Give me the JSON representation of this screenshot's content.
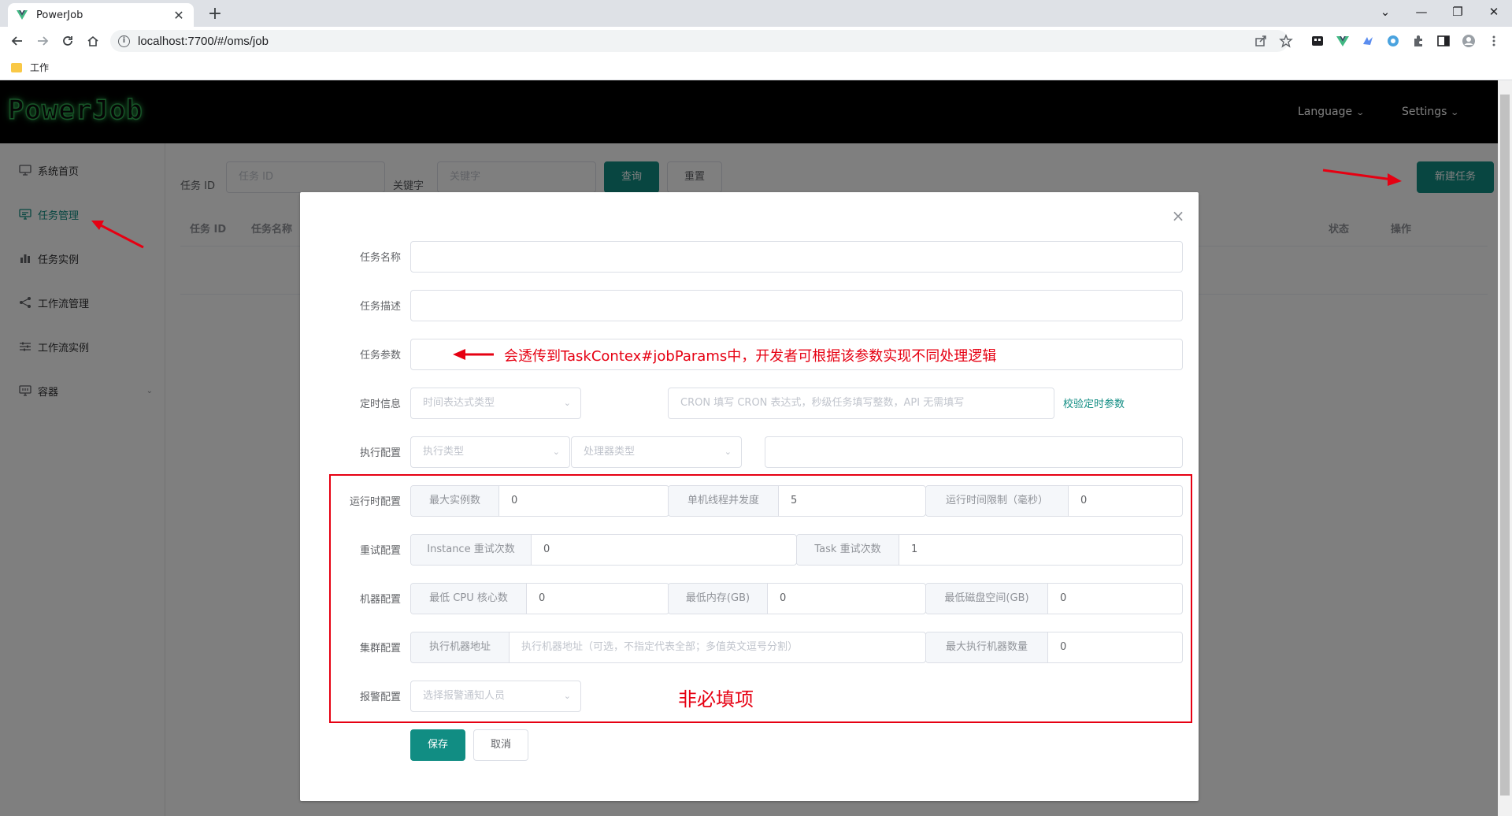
{
  "browser": {
    "tab_title": "PowerJob",
    "new_tab": "+",
    "url": "localhost:7700/#/oms/job",
    "bookmark": "工作",
    "win_min": "—",
    "win_restore": "❐",
    "win_close": "✕",
    "tab_menu": "⌄"
  },
  "app": {
    "logo": "PowerJob",
    "language_label": "Language",
    "settings_label": "Settings"
  },
  "sidebar": {
    "items": [
      {
        "label": "系统首页",
        "icon": "monitor-icon"
      },
      {
        "label": "任务管理",
        "icon": "task-icon"
      },
      {
        "label": "任务实例",
        "icon": "bar-chart-icon"
      },
      {
        "label": "工作流管理",
        "icon": "share-icon"
      },
      {
        "label": "工作流实例",
        "icon": "sliders-icon"
      },
      {
        "label": "容器",
        "icon": "container-icon"
      }
    ]
  },
  "filter": {
    "task_id_label": "任务 ID",
    "task_id_placeholder": "任务 ID",
    "keyword_label": "关键字",
    "keyword_placeholder": "关键字",
    "query_button": "查询",
    "reset_button": "重置",
    "new_task_button": "新建任务"
  },
  "table": {
    "headers": [
      "任务 ID",
      "任务名称",
      "状态",
      "操作"
    ]
  },
  "dialog": {
    "close": "×",
    "labels": {
      "name": "任务名称",
      "desc": "任务描述",
      "params": "任务参数",
      "timing": "定时信息",
      "exec": "执行配置",
      "runtime": "运行时配置",
      "retry": "重试配置",
      "machine": "机器配置",
      "cluster": "集群配置",
      "alarm": "报警配置"
    },
    "name_value": "",
    "desc_value": "",
    "params_value": "",
    "timing_type_placeholder": "时间表达式类型",
    "timing_expr_placeholder": "CRON 填写 CRON 表达式，秒级任务填写整数，API 无需填写",
    "validate_link": "校验定时参数",
    "exec_type_placeholder": "执行类型",
    "processor_type_placeholder": "处理器类型",
    "processor_info_value": "",
    "runtime": {
      "max_instance_label": "最大实例数",
      "max_instance_value": "0",
      "concurrency_label": "单机线程并发度",
      "concurrency_value": "5",
      "time_limit_label": "运行时间限制（毫秒）",
      "time_limit_value": "0"
    },
    "retry": {
      "instance_label": "Instance 重试次数",
      "instance_value": "0",
      "task_label": "Task 重试次数",
      "task_value": "1"
    },
    "machine": {
      "cpu_label": "最低 CPU 核心数",
      "cpu_value": "0",
      "memory_label": "最低内存(GB)",
      "memory_value": "0",
      "disk_label": "最低磁盘空间(GB)",
      "disk_value": "0"
    },
    "cluster": {
      "address_label": "执行机器地址",
      "address_placeholder": "执行机器地址（可选，不指定代表全部；多值英文逗号分割）",
      "max_workers_label": "最大执行机器数量",
      "max_workers_value": "0"
    },
    "alarm_placeholder": "选择报警通知人员",
    "save_button": "保存",
    "cancel_button": "取消"
  },
  "annotations": {
    "params_note": "会透传到TaskContex#jobParams中，开发者可根据该参数实现不同处理逻辑",
    "optional_note": "非必填项",
    "color": "#e60012"
  },
  "colors": {
    "primary": "#118d83",
    "header_bg": "#000000",
    "logo_glow": "#2fa84f"
  }
}
